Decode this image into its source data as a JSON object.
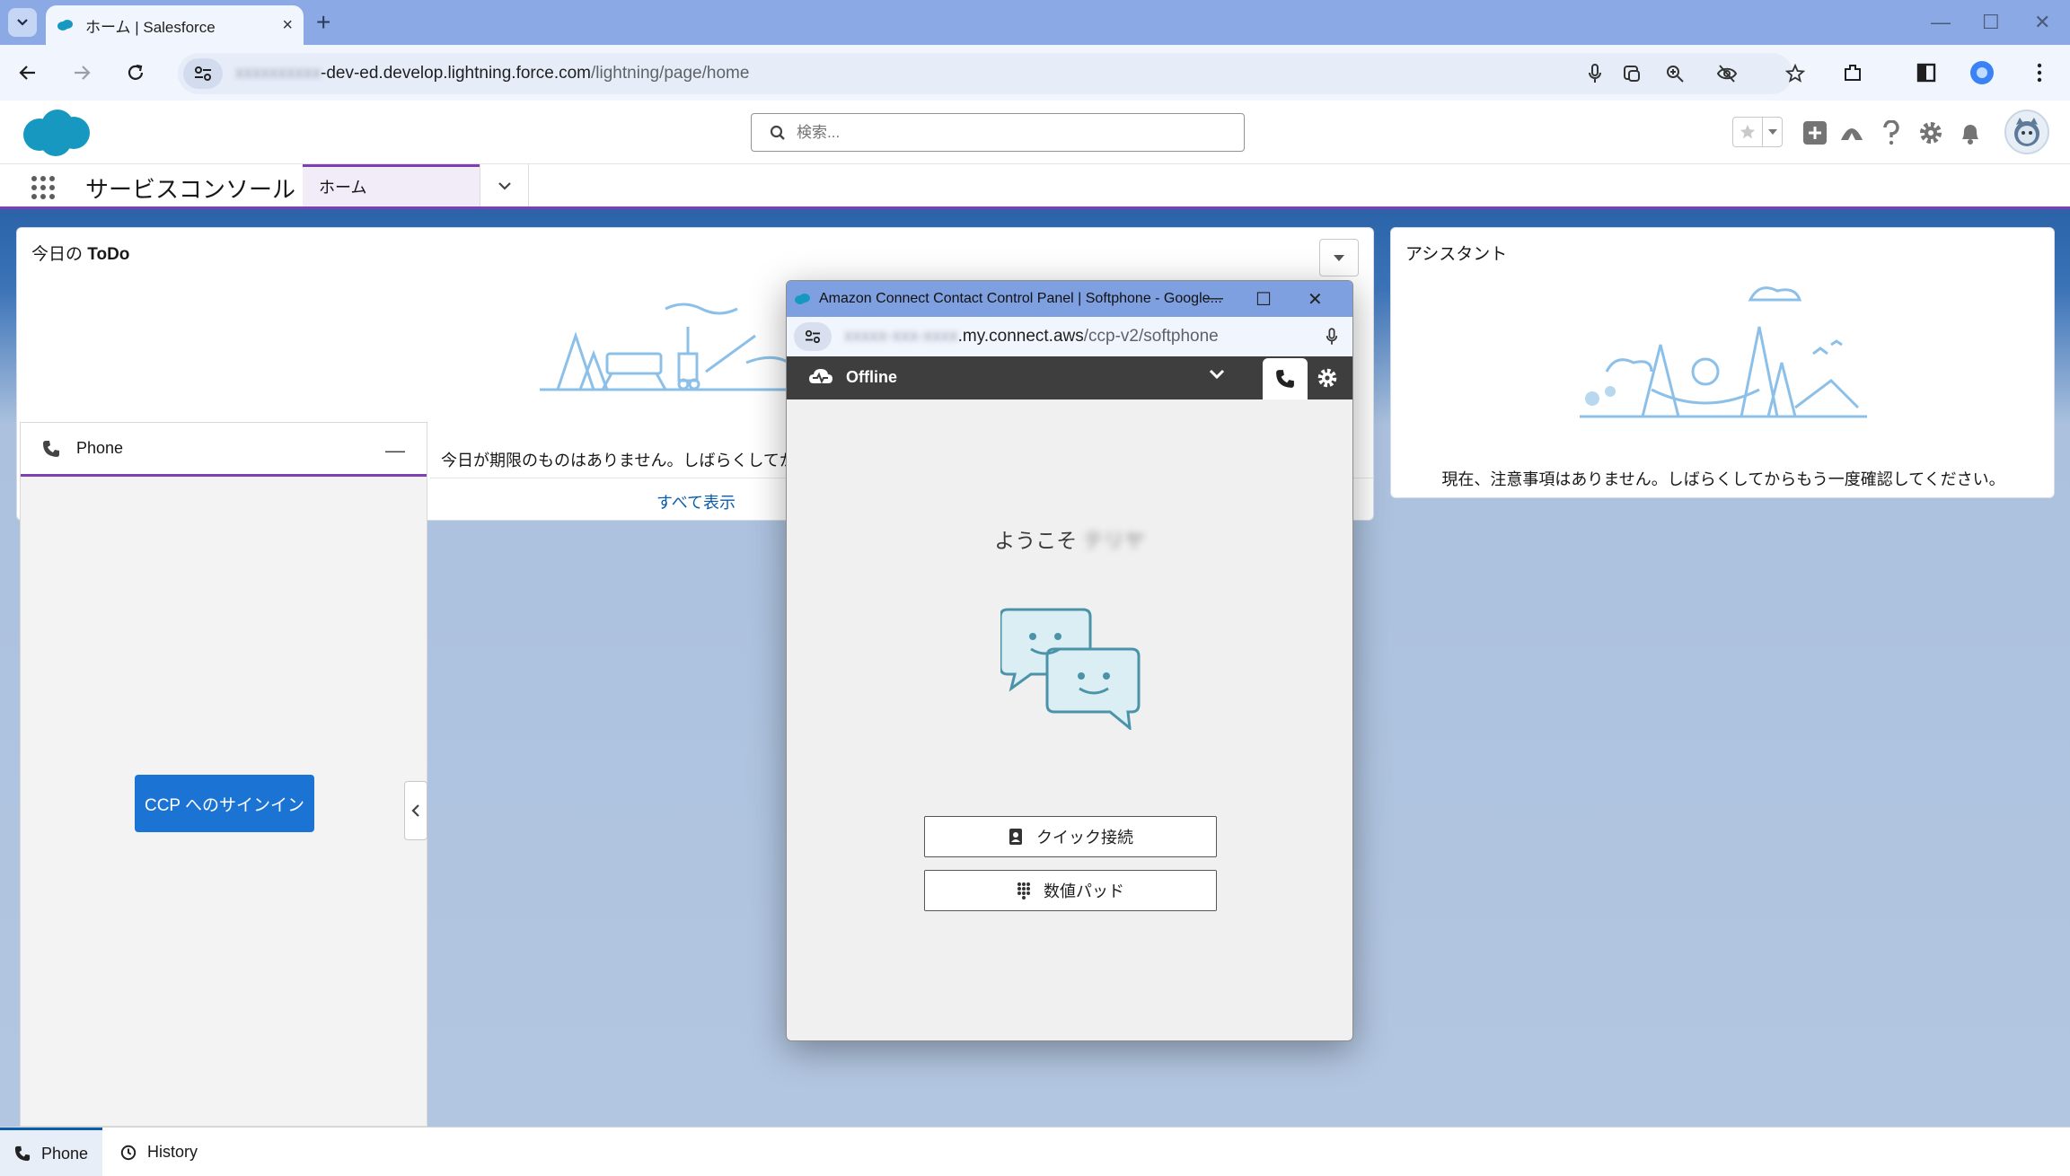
{
  "browser": {
    "tab_title": "ホーム | Salesforce",
    "tab_close": "×",
    "new_tab": "+",
    "url_blurred": "xxxxxxxxxx",
    "url_host": "-dev-ed.develop.lightning.force.com",
    "url_path": "/lightning/page/home",
    "window_controls": [
      "—",
      "☐",
      "✕"
    ]
  },
  "sf_header": {
    "search_placeholder": "検索..."
  },
  "app_nav": {
    "app_name": "サービスコンソール",
    "tab_label": "ホーム"
  },
  "todo": {
    "title_prefix": "今日の ",
    "title_bold": "ToDo",
    "message": "今日が期限のものはありません。しばらくしてから",
    "view_all": "すべて表示"
  },
  "assistant": {
    "title": "アシスタント",
    "message": "現在、注意事項はありません。しばらくしてからもう一度確認してください。"
  },
  "phone_panel": {
    "title": "Phone",
    "minimize": "—",
    "signin_button": "CCP へのサインイン"
  },
  "utility_bar": {
    "phone": "Phone",
    "history": "History"
  },
  "popup": {
    "window_title": "Amazon Connect Contact Control Panel | Softphone - Google...",
    "url_blurred": "xxxxx-xxx-xxxx",
    "url_host": ".my.connect.aws",
    "url_path": "/ccp-v2/softphone",
    "controls": [
      "—",
      "☐",
      "✕"
    ],
    "status": "Offline",
    "welcome": "ようこそ",
    "welcome_name_blurred": "テリヤ",
    "quick_connect": "クイック接続",
    "numpad": "数値パッド"
  },
  "colors": {
    "brand_purple": "#7f3fb3",
    "button_blue": "#1b74d4",
    "link_blue": "#0b5cab",
    "ccp_dark": "#3e3e3e",
    "illus_teal": "#4a93a9"
  },
  "icons": {
    "browser": [
      "tab-list-icon",
      "back-icon",
      "forward-icon",
      "reload-icon",
      "site-info-icon",
      "mic-icon",
      "cast-icon",
      "zoom-icon",
      "eye-off-icon",
      "star-icon",
      "extensions-icon",
      "sidebar-icon",
      "profile-icon",
      "menu-icon"
    ],
    "salesforce": [
      "salesforce-logo",
      "search-icon",
      "favorite-star-icon",
      "add-icon",
      "trailhead-icon",
      "help-icon",
      "setup-gear-icon",
      "bell-icon",
      "avatar",
      "app-launcher-icon"
    ],
    "ccp": [
      "cloud-status-icon",
      "chevron-down-icon",
      "phone-icon",
      "gear-icon",
      "contacts-icon",
      "keypad-icon"
    ]
  }
}
